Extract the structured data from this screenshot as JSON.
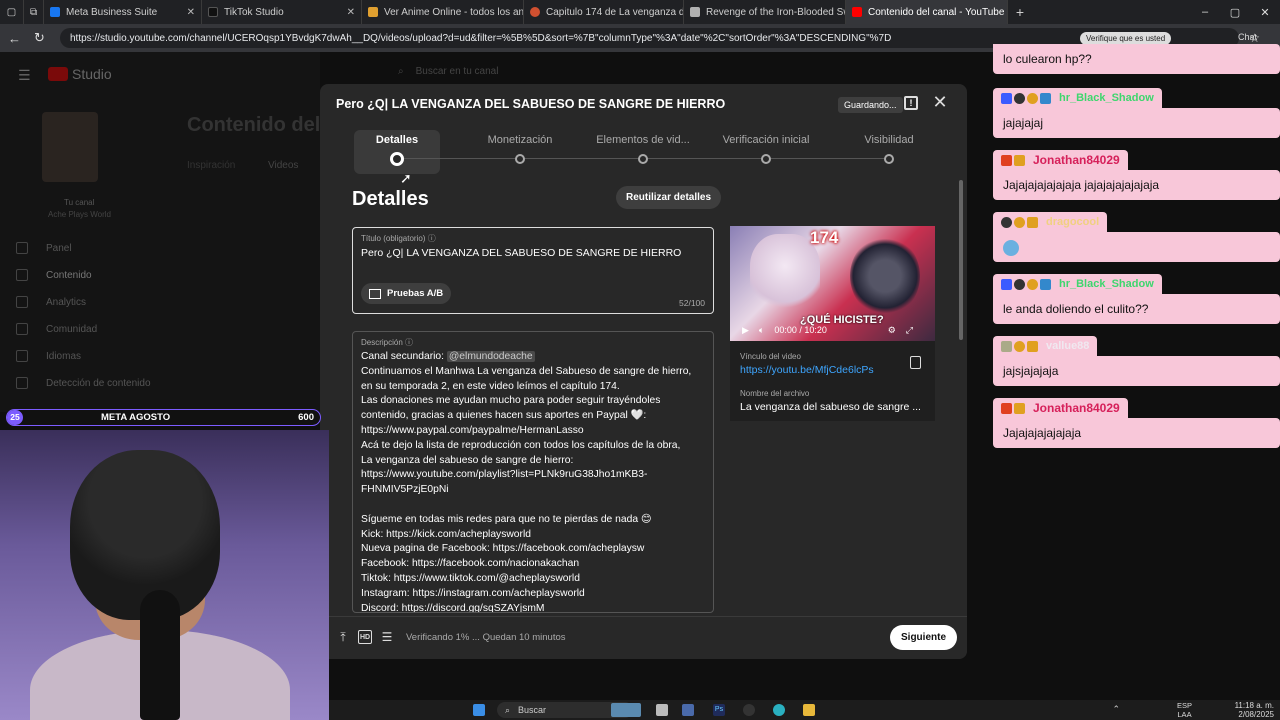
{
  "browser": {
    "tabs": [
      {
        "label": "Meta Business Suite",
        "color": "#1877f2"
      },
      {
        "label": "TikTok Studio",
        "color": "#111111"
      },
      {
        "label": "Ver Anime Online - todos los anim",
        "color": "#e0a030"
      },
      {
        "label": "Capitulo 174 de La venganza del s",
        "color": "#d05030"
      },
      {
        "label": "Revenge of the Iron-Blooded Swo",
        "color": "#b0b0b0"
      },
      {
        "label": "Contenido del canal - YouTube Stu",
        "color": "#ff0000",
        "active": true
      }
    ],
    "url": "https://studio.youtube.com/channel/UCEROqsp1YBvdgK7dwAh__DQ/videos/upload?d=ud&filter=%5B%5D&sort=%7B\"columnType\"%3A\"date\"%2C\"sortOrder\"%3A\"DESCENDING\"%7D"
  },
  "studio_bg": {
    "logo": "Studio",
    "search_placeholder": "Buscar en tu canal",
    "page_title": "Contenido del",
    "tab_inspiracion": "Inspiración",
    "tab_videos": "Videos",
    "channel_label": "Tu canal",
    "channel_name": "Ache Plays World",
    "side": [
      "Panel",
      "Contenido",
      "Analytics",
      "Comunidad",
      "Idiomas",
      "Detección de contenido"
    ]
  },
  "dialog": {
    "title": "Pero ¿Q| LA VENGANZA DEL SABUESO DE SANGRE DE HIERRO",
    "saving": "Guardando...",
    "steps": [
      "Detalles",
      "Monetización",
      "Elementos de vid...",
      "Verificación inicial",
      "Visibilidad"
    ],
    "heading": "Detalles",
    "reuse": "Reutilizar detalles",
    "title_field": {
      "label": "Título (obligatorio)",
      "value": "Pero ¿Q| LA VENGANZA DEL SABUESO DE SANGRE DE HIERRO",
      "ab": "Pruebas A/B",
      "count": "52/100"
    },
    "description": {
      "label": "Descripción",
      "first_prefix": "Canal secundario: ",
      "mention": "@elmundodeache",
      "lines": [
        "Continuamos el Manhwa La venganza del Sabueso de sangre de hierro,",
        "en su temporada 2, en este video leímos el capítulo 174.",
        "Las donaciones me ayudan mucho para poder seguir trayéndoles",
        "contenido, gracias a quienes hacen sus aportes en Paypal 🤍:",
        "https://www.paypal.com/paypalme/HermanLasso",
        "Acá te dejo la lista de reproducción con todos los capítulos de la obra,",
        "La venganza del sabueso de sangre de hierro:",
        "https://www.youtube.com/playlist?list=PLNk9ruG38Jho1mKB3-",
        "FHNMIV5PzjE0pNi",
        "",
        "Sígueme en todas mis redes para que no te pierdas de nada 😊",
        "Kick: https://kick.com/acheplaysworld",
        "Nueva pagina de Facebook: https://facebook.com/acheplaysw",
        "Facebook: https://facebook.com/nacionakachan",
        "Tiktok: https://www.tiktok.com/@acheplaysworld",
        "Instagram: https://instagram.com/acheplaysworld",
        "Discord: https://discord.gg/sqSZAYjsmM"
      ]
    },
    "preview": {
      "badge": "174",
      "time": "00:00 / 10:20",
      "overlay_text": "¿QUÉ HICISTE?"
    },
    "video_link_label": "Vínculo del video",
    "video_link": "https://youtu.be/MfjCde6lcPs",
    "file_label": "Nombre del archivo",
    "file_name": "La venganza del sabueso de sangre ...",
    "status": "Verificando 1% ... Quedan 10 minutos",
    "next": "Siguiente"
  },
  "chat": {
    "top_right_text": "Verifique que es usted",
    "chat_label": "Chat",
    "messages": [
      {
        "user": "",
        "text": "lo culearon hp??"
      },
      {
        "user": "hr_Black_Shadow",
        "text": "jajajajaj"
      },
      {
        "user": "Jonathan84029",
        "text": "Jajajajajajajaja jajajajajajajaja"
      },
      {
        "user": "dragocool",
        "text": ""
      },
      {
        "user": "hr_Black_Shadow",
        "text": "le anda doliendo el culito??"
      },
      {
        "user": "vallue88",
        "text": "jajsjajajaja"
      },
      {
        "user": "Jonathan84029",
        "text": "Jajajajajajajaja"
      }
    ]
  },
  "overlay": {
    "goal_left": "25",
    "goal_title": "META AGOSTO",
    "goal_right": "600"
  },
  "taskbar": {
    "search": "Buscar",
    "lang_top": "ESP",
    "lang_bottom": "LAA",
    "time": "11:18 a. m.",
    "date": "2/08/2025"
  }
}
